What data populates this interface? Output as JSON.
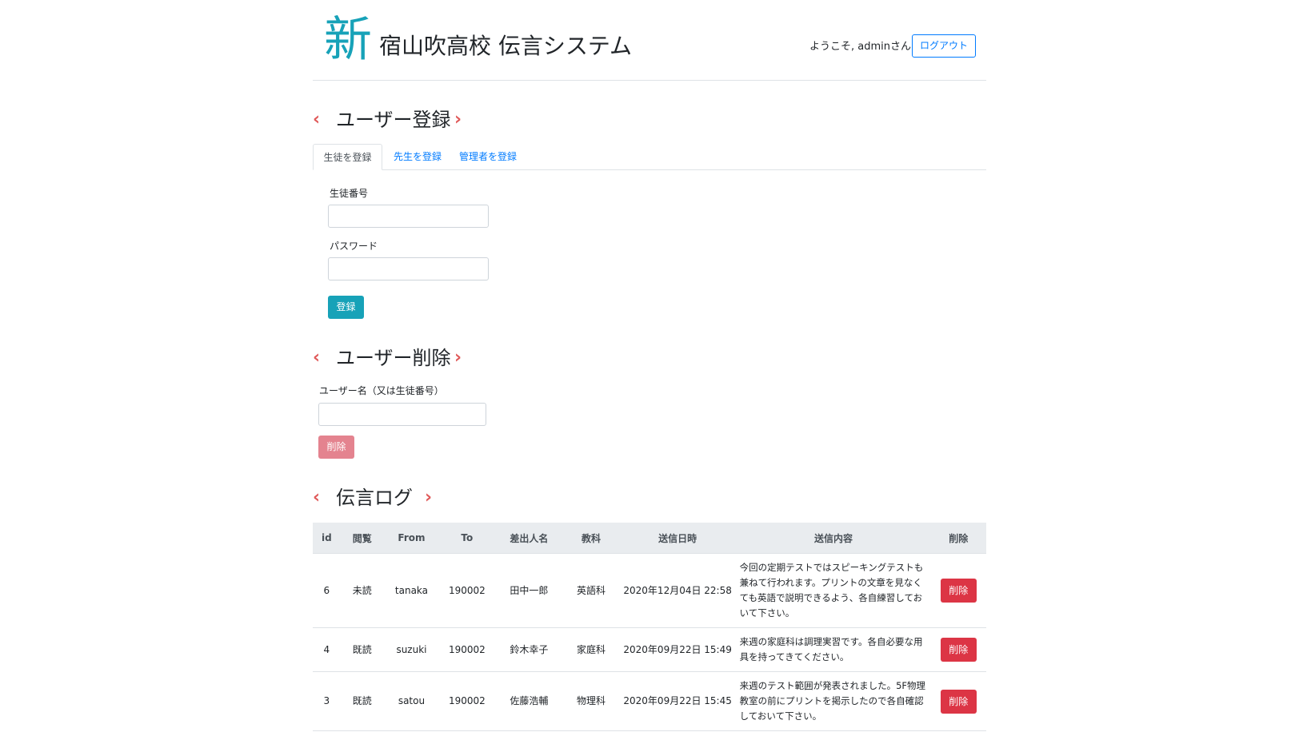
{
  "header": {
    "logo_mark": "新",
    "site_title": "宿山吹高校 伝言システム",
    "welcome": "ようこそ, adminさん",
    "logout_label": "ログアウト"
  },
  "register": {
    "title": "ユーザー登録",
    "tabs": [
      {
        "label": "生徒を登録",
        "active": true
      },
      {
        "label": "先生を登録",
        "active": false
      },
      {
        "label": "管理者を登録",
        "active": false
      }
    ],
    "student_number_label": "生徒番号",
    "student_number_value": "",
    "password_label": "パスワード",
    "password_value": "",
    "submit_label": "登録"
  },
  "delete_user": {
    "title": "ユーザー削除",
    "username_label": "ユーザー名（又は生徒番号）",
    "username_value": "",
    "submit_label": "削除"
  },
  "log": {
    "title": "伝言ログ",
    "columns": [
      "id",
      "閲覧",
      "From",
      "To",
      "差出人名",
      "教科",
      "送信日時",
      "送信内容",
      "削除"
    ],
    "rows": [
      {
        "id": "6",
        "read": "未読",
        "from": "tanaka",
        "to": "190002",
        "sender": "田中一郎",
        "subject": "英語科",
        "datetime": "2020年12月04日 22:58",
        "message": "今回の定期テストではスピーキングテストも兼ねて行われます。プリントの文章を見なくても英語で説明できるよう、各自練習しておいて下さい。",
        "delete_label": "削除"
      },
      {
        "id": "4",
        "read": "既読",
        "from": "suzuki",
        "to": "190002",
        "sender": "鈴木幸子",
        "subject": "家庭科",
        "datetime": "2020年09月22日 15:49",
        "message": "来週の家庭科は調理実習です。各自必要な用具を持ってきてください。",
        "delete_label": "削除"
      },
      {
        "id": "3",
        "read": "既読",
        "from": "satou",
        "to": "190002",
        "sender": "佐藤浩輔",
        "subject": "物理科",
        "datetime": "2020年09月22日 15:45",
        "message": "来週のテスト範囲が発表されました。5F物理教室の前にプリントを掲示したので各自確認しておいて下さい。",
        "delete_label": "削除"
      }
    ]
  },
  "colors": {
    "accent": "#17a2b8",
    "link": "#007bff",
    "chevron": "#e05a5a",
    "danger": "#dc3545",
    "danger_disabled": "#e4838f"
  },
  "icons": [
    "chevron-left-icon",
    "chevron-right-icon"
  ]
}
